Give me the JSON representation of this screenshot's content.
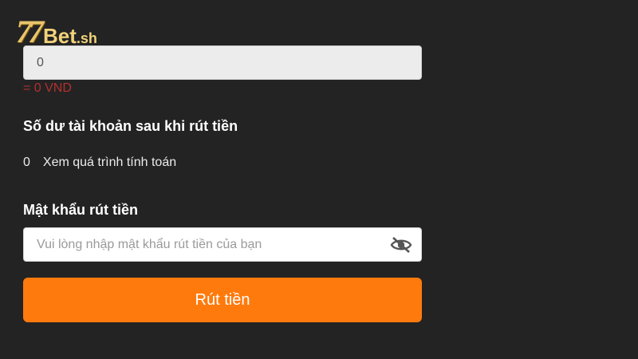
{
  "logo": {
    "number": "77",
    "brand": "Bet",
    "tld": ".sh"
  },
  "amount": {
    "value": "0",
    "converted": "= 0 VND"
  },
  "balance": {
    "title": "Số dư tài khoản sau khi rút tiền",
    "value": "0",
    "calc_link": "Xem quá trình tính toán"
  },
  "password": {
    "title": "Mật khẩu rút tiền",
    "placeholder": "Vui lòng nhập mật khẩu rút tiền của bạn",
    "toggle_icon": "eye-slash-icon"
  },
  "submit": {
    "label": "Rút tiền"
  },
  "colors": {
    "background": "#232323",
    "accent": "#ff7a0c",
    "error": "#b42f2f",
    "logo_gold": "#e9c46a"
  }
}
